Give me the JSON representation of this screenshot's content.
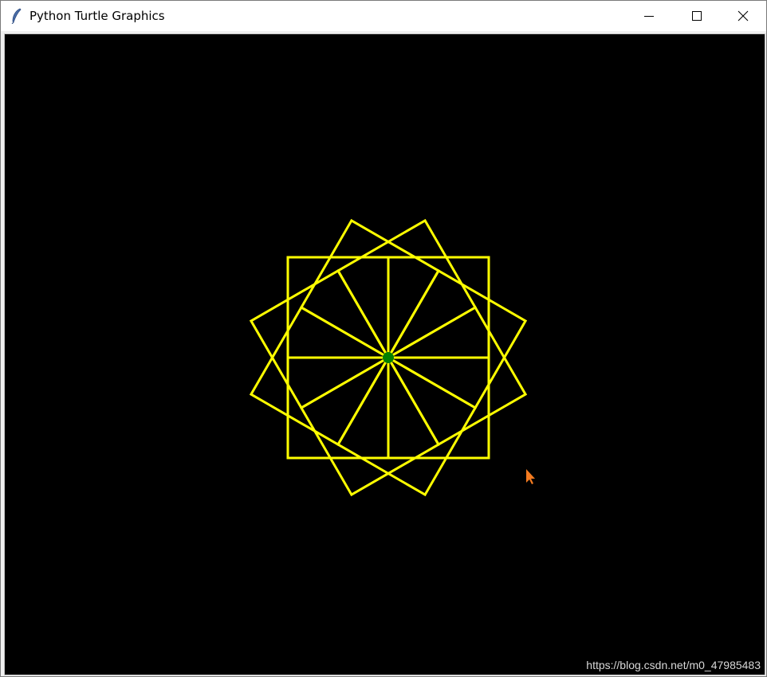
{
  "window": {
    "title": "Python Turtle Graphics",
    "icons": {
      "app": "feather-icon",
      "minimize": "minimize-icon",
      "maximize": "maximize-icon",
      "close": "close-icon"
    }
  },
  "canvas": {
    "background": "#000000",
    "pen_color": "#ffff00",
    "turtle_color": "#008000",
    "cursor_color": "#f47b20",
    "squares": {
      "count": 12,
      "rotation_step_degrees": 30
    }
  },
  "watermark": "https://blog.csdn.net/m0_47985483"
}
